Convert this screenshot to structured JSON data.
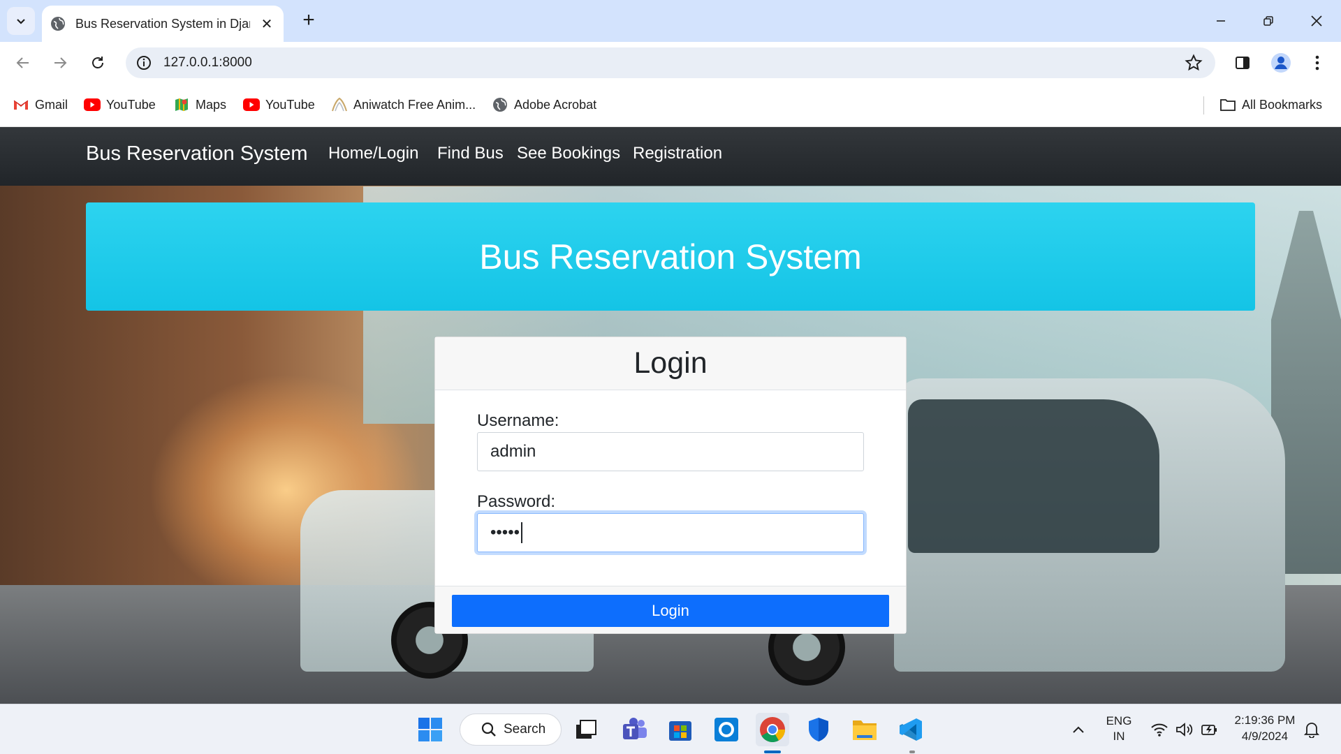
{
  "browser": {
    "tab_title": "Bus Reservation System in Djan",
    "url": "127.0.0.1:8000"
  },
  "bookmarks": [
    {
      "label": "Gmail",
      "icon": "gmail-icon"
    },
    {
      "label": "YouTube",
      "icon": "youtube-icon"
    },
    {
      "label": "Maps",
      "icon": "maps-icon"
    },
    {
      "label": "YouTube",
      "icon": "youtube-icon"
    },
    {
      "label": "Aniwatch Free Anim...",
      "icon": "aniwatch-icon"
    },
    {
      "label": "Adobe Acrobat",
      "icon": "globe-icon"
    }
  ],
  "all_bookmarks_label": "All Bookmarks",
  "site": {
    "brand": "Bus Reservation System",
    "nav": [
      "Home/Login",
      "Find Bus",
      "See Bookings",
      "Registration"
    ],
    "hero_title": "Bus Reservation System",
    "login": {
      "heading": "Login",
      "username_label": "Username:",
      "username_value": "admin",
      "password_label": "Password:",
      "password_mask": "•••••",
      "submit_label": "Login"
    },
    "colors": {
      "navbar": "#212529",
      "hero": "#1ccbe9",
      "button": "#0d6efd"
    }
  },
  "taskbar": {
    "search_label": "Search",
    "lang_line1": "ENG",
    "lang_line2": "IN",
    "time": "2:19:36 PM",
    "date": "4/9/2024"
  }
}
